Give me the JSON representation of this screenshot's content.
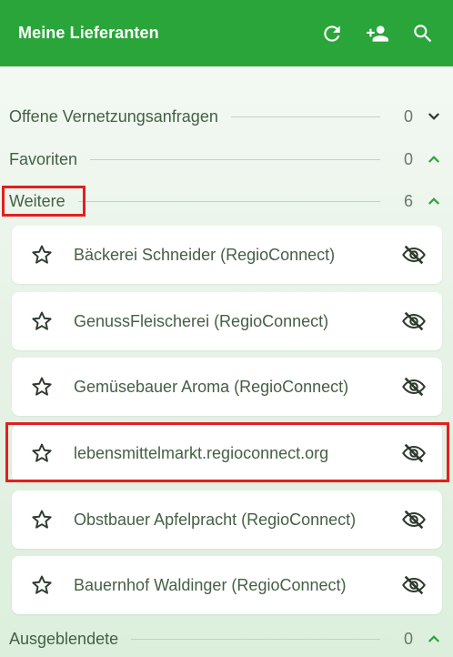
{
  "appbar": {
    "title": "Meine Lieferanten",
    "icons": [
      "refresh-icon",
      "add-person-icon",
      "search-icon"
    ]
  },
  "sections": {
    "offene": {
      "label": "Offene Vernetzungsanfragen",
      "count": "0",
      "state": "collapsed"
    },
    "favoriten": {
      "label": "Favoriten",
      "count": "0",
      "state": "expanded"
    },
    "weitere": {
      "label": "Weitere",
      "count": "6",
      "state": "expanded"
    },
    "ausgeblendete": {
      "label": "Ausgeblendete",
      "count": "0",
      "state": "expanded"
    }
  },
  "suppliers": [
    {
      "name": "Bäckerei Schneider (RegioConnect)"
    },
    {
      "name": "GenussFleischerei (RegioConnect)"
    },
    {
      "name": "Gemüsebauer Aroma (RegioConnect)"
    },
    {
      "name": "lebensmittelmarkt.regioconnect.org"
    },
    {
      "name": "Obstbauer Apfelpracht (RegioConnect)"
    },
    {
      "name": "Bauernhof Waldinger (RegioConnect)"
    }
  ],
  "colors": {
    "appbar": "#2aa53a",
    "accent_green": "#2aa53a",
    "text": "#456045",
    "highlight": "#e02020"
  }
}
